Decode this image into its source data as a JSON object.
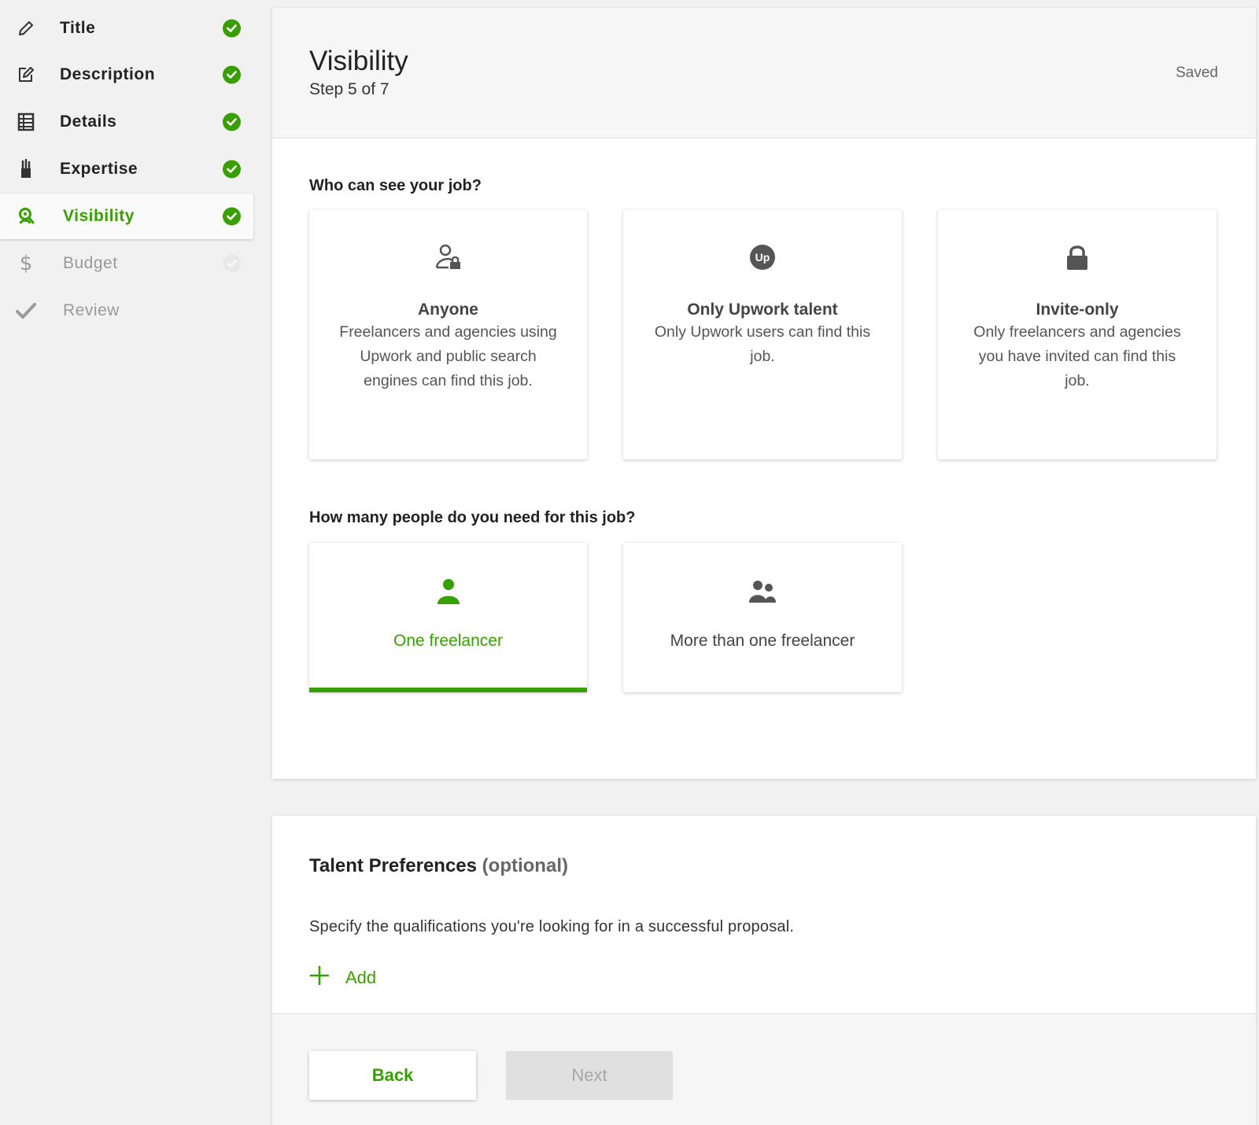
{
  "sidebar": {
    "items": [
      {
        "label": "Title",
        "icon": "pencil-icon",
        "status": "complete"
      },
      {
        "label": "Description",
        "icon": "edit-icon",
        "status": "complete"
      },
      {
        "label": "Details",
        "icon": "list-icon",
        "status": "complete"
      },
      {
        "label": "Expertise",
        "icon": "brush-icon",
        "status": "complete"
      },
      {
        "label": "Visibility",
        "icon": "visibility-icon",
        "status": "complete",
        "active": true
      },
      {
        "label": "Budget",
        "icon": "dollar-icon",
        "status": "incomplete"
      },
      {
        "label": "Review",
        "icon": "checkmark-icon",
        "status": "incomplete"
      }
    ]
  },
  "header": {
    "title": "Visibility",
    "step": "Step 5 of 7",
    "save_status": "Saved"
  },
  "visibility": {
    "question": "Who can see your job?",
    "options": [
      {
        "title": "Anyone",
        "description": "Freelancers and agencies using Upwork and public search engines can find this job.",
        "icon": "public-user-icon"
      },
      {
        "title": "Only Upwork talent",
        "description": "Only Upwork users can find this job.",
        "icon": "upwork-logo-icon"
      },
      {
        "title": "Invite-only",
        "description": "Only freelancers and agencies you have invited can find this job.",
        "icon": "lock-icon"
      }
    ]
  },
  "people": {
    "question": "How many people do you need for this job?",
    "options": [
      {
        "title": "One freelancer",
        "icon": "single-person-icon",
        "selected": true
      },
      {
        "title": "More than one freelancer",
        "icon": "group-icon",
        "selected": false
      }
    ]
  },
  "talent_preferences": {
    "title": "Talent Preferences",
    "optional": "(optional)",
    "description": "Specify the qualifications you're looking for in a successful proposal.",
    "add_label": "Add"
  },
  "footer": {
    "back_label": "Back",
    "next_label": "Next"
  },
  "colors": {
    "accent": "#37a000",
    "disabled": "#e0e0e0",
    "text": "#222222",
    "background": "#f1f1f1"
  }
}
